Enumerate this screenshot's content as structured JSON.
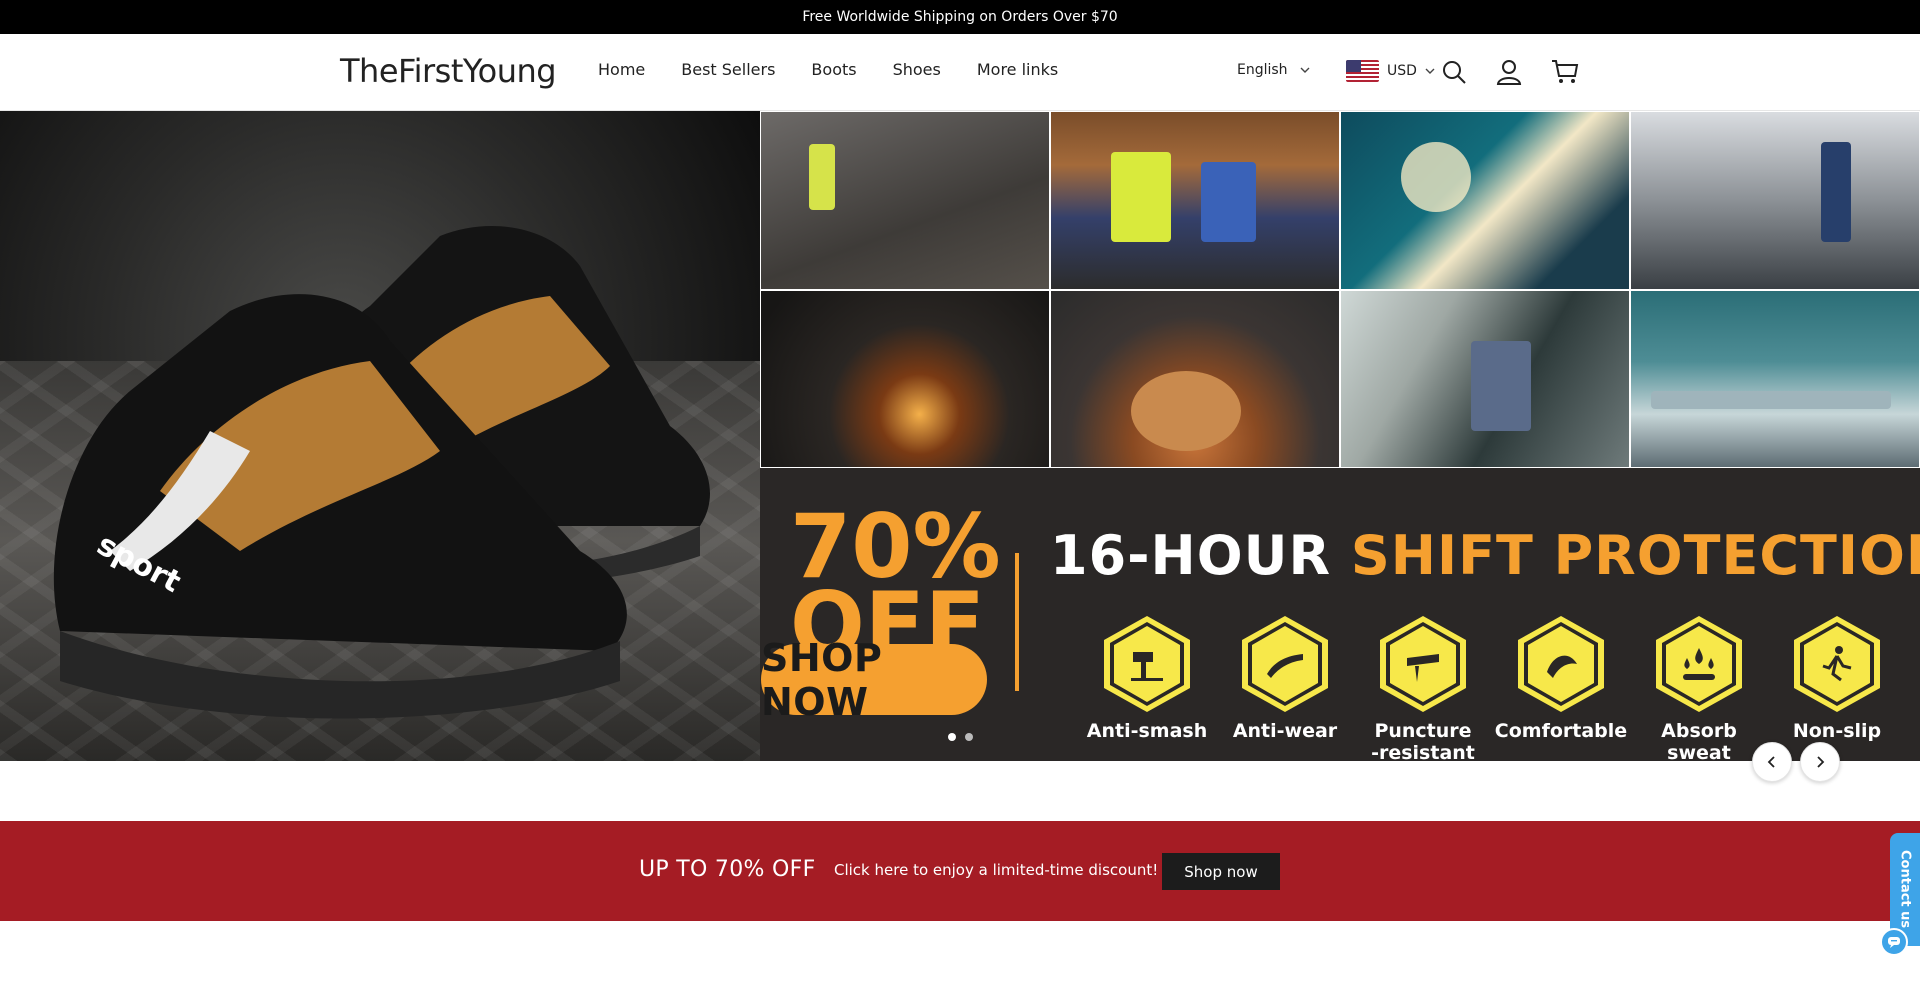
{
  "announcement": {
    "text": "Free Worldwide Shipping on Orders Over $70"
  },
  "header": {
    "logo": "TheFirstYoung",
    "nav": [
      {
        "label": "Home"
      },
      {
        "label": "Best Sellers"
      },
      {
        "label": "Boots"
      },
      {
        "label": "Shoes"
      },
      {
        "label": "More links"
      }
    ],
    "language": "English",
    "currency": "USD",
    "icons": [
      "search-icon",
      "account-icon",
      "cart-icon"
    ]
  },
  "hero": {
    "shoe_brand": "sport",
    "discount_line1": "70%",
    "discount_line2": "OFF",
    "shop_now": "SHOP NOW",
    "headline_white": "16-HOUR",
    "headline_orange": "SHIFT PROTECTION",
    "features": [
      {
        "label": "Anti-smash",
        "icon": "hammer-icon"
      },
      {
        "label": "Anti-wear",
        "icon": "wear-icon"
      },
      {
        "label": "Puncture\n-resistant",
        "icon": "puncture-icon"
      },
      {
        "label": "Comfortable",
        "icon": "comfort-icon"
      },
      {
        "label": "Absorb sweat",
        "icon": "sweat-icon"
      },
      {
        "label": "Non-slip",
        "icon": "slip-icon"
      }
    ],
    "slides": {
      "count": 2,
      "active": 0
    },
    "accent_color": "#f5a030",
    "feature_color": "#f7e84a"
  },
  "banner": {
    "title": "UP TO 70% OFF",
    "subtitle": "Click here to enjoy a limited-time discount!",
    "button": "Shop now",
    "background": "#a51c24"
  },
  "contact": {
    "label": "Contact us"
  }
}
